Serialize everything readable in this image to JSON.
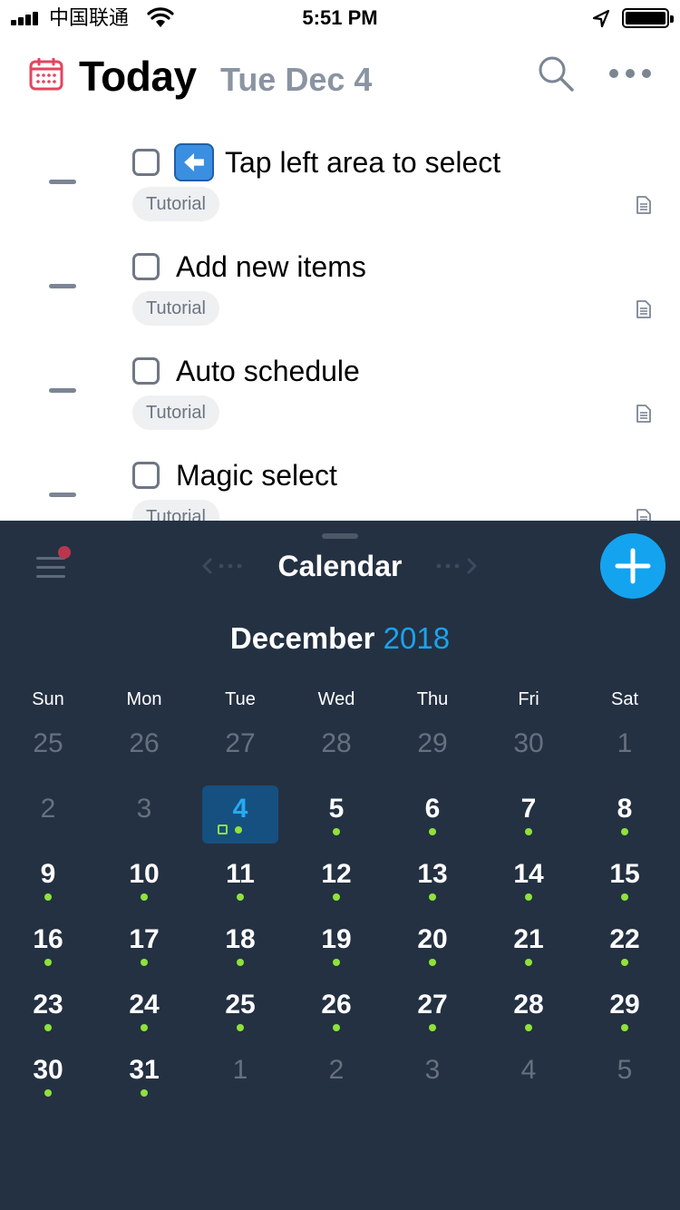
{
  "status_bar": {
    "carrier": "中国联通",
    "time": "5:51 PM"
  },
  "header": {
    "title": "Today",
    "date": "Tue Dec 4"
  },
  "tasks": [
    {
      "title": "Tap left area to select",
      "tag": "Tutorial",
      "has_emoji": true,
      "emoji": "left-arrow-icon"
    },
    {
      "title": "Add new items",
      "tag": "Tutorial"
    },
    {
      "title": "Auto schedule",
      "tag": "Tutorial"
    },
    {
      "title": "Magic select",
      "tag": "Tutorial"
    }
  ],
  "panel": {
    "title": "Calendar"
  },
  "calendar": {
    "month": "December",
    "year": "2018",
    "weekdays": [
      "Sun",
      "Mon",
      "Tue",
      "Wed",
      "Thu",
      "Fri",
      "Sat"
    ],
    "weeks": [
      [
        {
          "d": "25",
          "m": true
        },
        {
          "d": "26",
          "m": true
        },
        {
          "d": "27",
          "m": true
        },
        {
          "d": "28",
          "m": true
        },
        {
          "d": "29",
          "m": true
        },
        {
          "d": "30",
          "m": true
        },
        {
          "d": "1",
          "m": true
        }
      ],
      [
        {
          "d": "2",
          "m": true
        },
        {
          "d": "3",
          "m": true
        },
        {
          "d": "4",
          "today": true,
          "dot": true
        },
        {
          "d": "5",
          "dot": true
        },
        {
          "d": "6",
          "dot": true
        },
        {
          "d": "7",
          "dot": true
        },
        {
          "d": "8",
          "dot": true
        }
      ],
      [
        {
          "d": "9",
          "dot": true
        },
        {
          "d": "10",
          "dot": true
        },
        {
          "d": "11",
          "dot": true
        },
        {
          "d": "12",
          "dot": true
        },
        {
          "d": "13",
          "dot": true
        },
        {
          "d": "14",
          "dot": true
        },
        {
          "d": "15",
          "dot": true
        }
      ],
      [
        {
          "d": "16",
          "dot": true
        },
        {
          "d": "17",
          "dot": true
        },
        {
          "d": "18",
          "dot": true
        },
        {
          "d": "19",
          "dot": true
        },
        {
          "d": "20",
          "dot": true
        },
        {
          "d": "21",
          "dot": true
        },
        {
          "d": "22",
          "dot": true
        }
      ],
      [
        {
          "d": "23",
          "dot": true
        },
        {
          "d": "24",
          "dot": true
        },
        {
          "d": "25",
          "dot": true
        },
        {
          "d": "26",
          "dot": true
        },
        {
          "d": "27",
          "dot": true
        },
        {
          "d": "28",
          "dot": true
        },
        {
          "d": "29",
          "dot": true
        }
      ],
      [
        {
          "d": "30",
          "dot": true
        },
        {
          "d": "31",
          "dot": true
        },
        {
          "d": "1",
          "m": true
        },
        {
          "d": "2",
          "m": true
        },
        {
          "d": "3",
          "m": true
        },
        {
          "d": "4",
          "m": true
        },
        {
          "d": "5",
          "m": true
        }
      ]
    ]
  },
  "colors": {
    "accent": "#14a3ef",
    "today_text": "#27a9f1",
    "event_dot": "#8fe23a",
    "panel_bg": "#243142",
    "calendar_icon": "#e5435f"
  }
}
